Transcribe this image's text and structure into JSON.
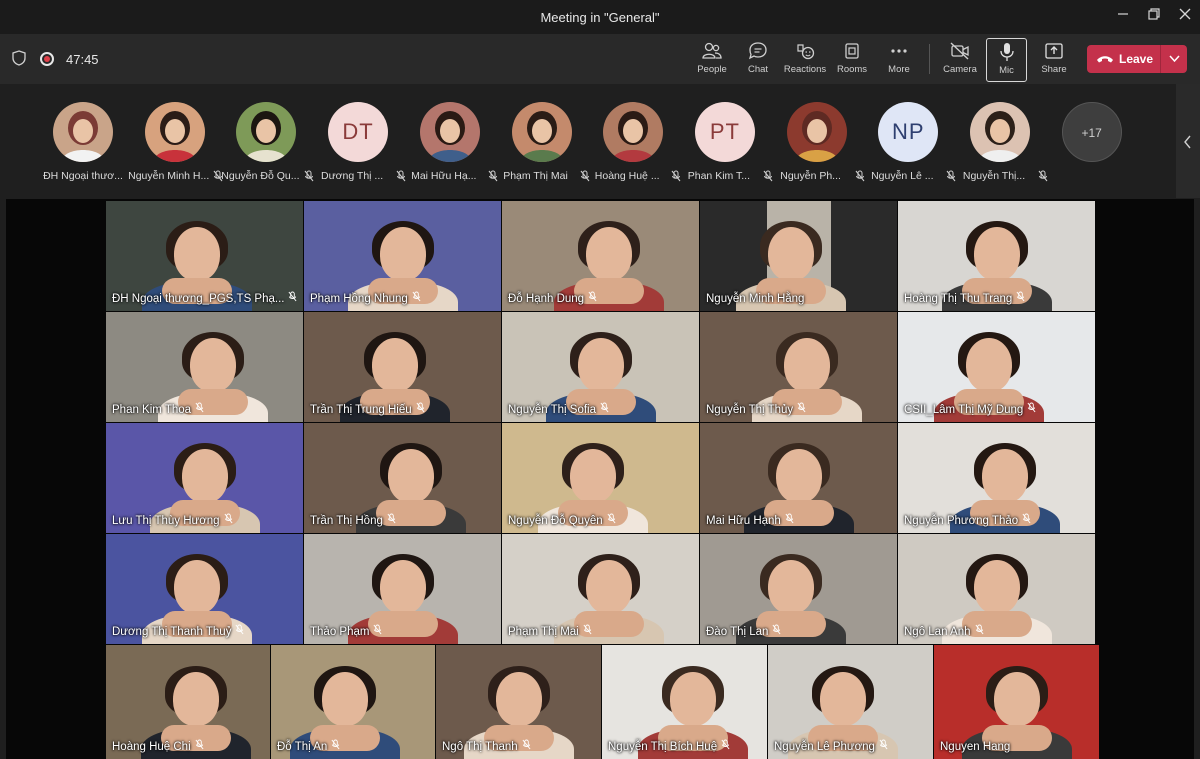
{
  "window": {
    "title": "Meeting in \"General\""
  },
  "toolbar": {
    "timer": "47:45",
    "buttons": [
      {
        "key": "people",
        "label": "People"
      },
      {
        "key": "chat",
        "label": "Chat"
      },
      {
        "key": "reactions",
        "label": "Reactions"
      },
      {
        "key": "rooms",
        "label": "Rooms"
      },
      {
        "key": "more",
        "label": "More"
      },
      {
        "key": "camera",
        "label": "Camera"
      },
      {
        "key": "mic",
        "label": "Mic"
      },
      {
        "key": "share",
        "label": "Share"
      }
    ],
    "leave_label": "Leave"
  },
  "strip": {
    "participants": [
      {
        "name": "ĐH Ngoại thươ...",
        "initials": ""
      },
      {
        "name": "Nguyễn Minh H...",
        "initials": ""
      },
      {
        "name": "Nguyễn Đỗ Qu...",
        "initials": ""
      },
      {
        "name": "Dương Thị ...",
        "initials": "DT"
      },
      {
        "name": "Mai Hữu Hạ...",
        "initials": ""
      },
      {
        "name": "Phạm Thị Mai",
        "initials": ""
      },
      {
        "name": "Hoàng Huệ ...",
        "initials": ""
      },
      {
        "name": "Phan Kim T...",
        "initials": "PT"
      },
      {
        "name": "Nguyễn Ph...",
        "initials": ""
      },
      {
        "name": "Nguyễn Lê ...",
        "initials": "NP"
      },
      {
        "name": "Nguyễn Thị...",
        "initials": ""
      }
    ],
    "overflow_count": "+17"
  },
  "grid": {
    "tiles": [
      {
        "name": "ĐH Ngoại thương_PGS,TS Phạ..."
      },
      {
        "name": "Phạm Hồng Nhung"
      },
      {
        "name": "Đỗ Hạnh Dung"
      },
      {
        "name": "Nguyễn Minh Hằng"
      },
      {
        "name": "Hoàng Thị Thu Trang"
      },
      {
        "name": "Phan Kim Thoa"
      },
      {
        "name": "Trần Thị Trung Hiếu"
      },
      {
        "name": "Nguyễn Thị Sofia"
      },
      {
        "name": "Nguyễn Thị Thủy"
      },
      {
        "name": "CSII_Lâm Thị Mỹ Dung"
      },
      {
        "name": "Lưu Thị Thùy Hương"
      },
      {
        "name": "Trần Thị Hồng"
      },
      {
        "name": "Nguyễn Đỗ Quyên"
      },
      {
        "name": "Mai Hữu Hạnh"
      },
      {
        "name": "Nguyễn Phương Thảo"
      },
      {
        "name": "Dương Thị Thanh Thuỷ"
      },
      {
        "name": "Thảo Phạm"
      },
      {
        "name": "Phạm Thị Mai"
      },
      {
        "name": "Đào Thị Lan"
      },
      {
        "name": "Ngô Lan Anh"
      },
      {
        "name": "Hoàng Huệ Chi"
      },
      {
        "name": "Đỗ Thị An"
      },
      {
        "name": "Ngô Thị Thanh"
      },
      {
        "name": "Nguyễn Thị Bích Huệ"
      },
      {
        "name": "Nguyễn Lê Phương"
      },
      {
        "name": "Nguyen Hang"
      }
    ]
  },
  "colors": {
    "leave": "#c4314b",
    "toolbar": "#292929",
    "background": "#1f1f1f"
  }
}
